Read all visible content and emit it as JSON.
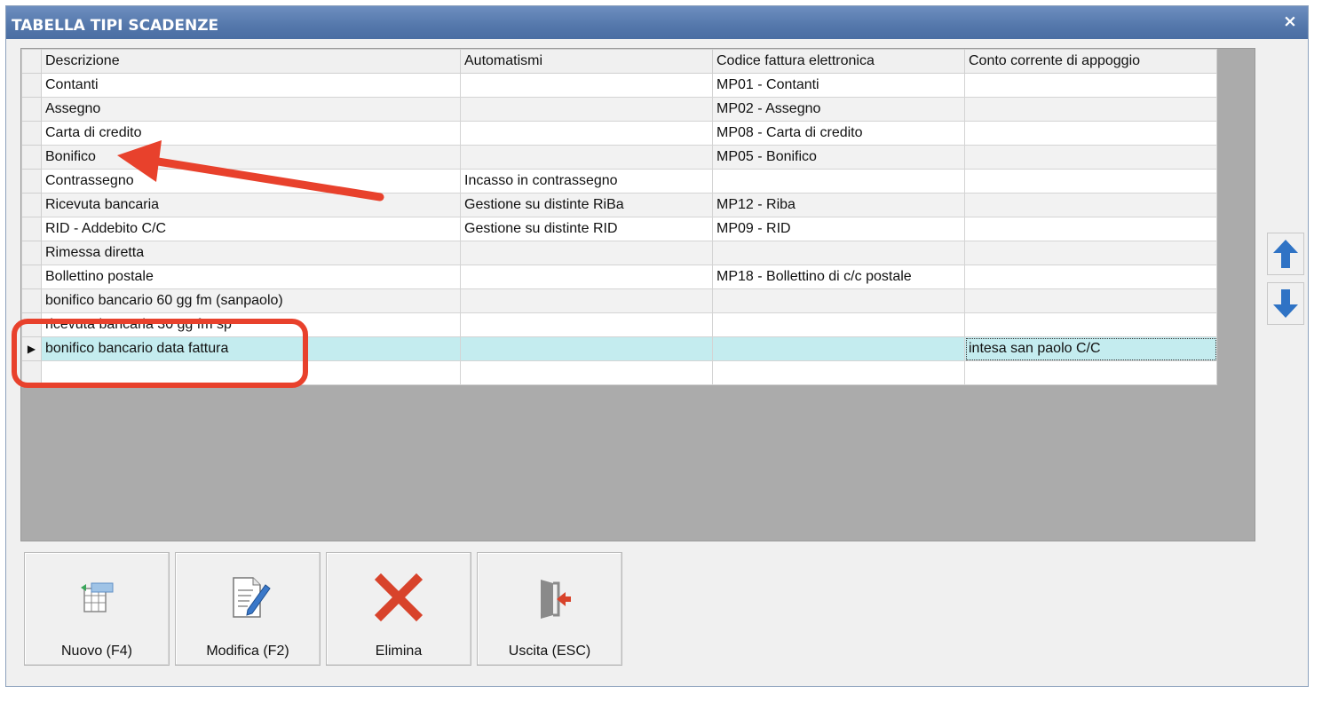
{
  "window": {
    "title": "TABELLA TIPI SCADENZE",
    "close_symbol": "×"
  },
  "grid": {
    "columns": [
      "Descrizione",
      "Automatismi",
      "Codice fattura elettronica",
      "Conto corrente di appoggio"
    ],
    "rows": [
      [
        "Contanti",
        "",
        "MP01 - Contanti",
        ""
      ],
      [
        "Assegno",
        "",
        "MP02 - Assegno",
        ""
      ],
      [
        "Carta di credito",
        "",
        "MP08 - Carta di credito",
        ""
      ],
      [
        "Bonifico",
        "",
        "MP05 - Bonifico",
        ""
      ],
      [
        "Contrassegno",
        "Incasso in contrassegno",
        "",
        ""
      ],
      [
        "Ricevuta bancaria",
        "Gestione su distinte RiBa",
        "MP12 - Riba",
        ""
      ],
      [
        "RID - Addebito C/C",
        "Gestione su distinte RID",
        "MP09 - RID",
        ""
      ],
      [
        "Rimessa diretta",
        "",
        "",
        ""
      ],
      [
        "Bollettino postale",
        "",
        "MP18 - Bollettino di c/c postale",
        ""
      ],
      [
        "bonifico bancario 60 gg fm (sanpaolo)",
        "",
        "",
        ""
      ],
      [
        "ricevuta bancaria 30 gg fm sp",
        "",
        "",
        ""
      ],
      [
        "bonifico bancario data fattura",
        "",
        "",
        "intesa san paolo C/C"
      ],
      [
        "",
        "",
        "",
        ""
      ]
    ],
    "selected_row_index": 11,
    "row_indicator": "▶"
  },
  "side_buttons": {
    "up_icon": "arrow-up-icon",
    "down_icon": "arrow-down-icon"
  },
  "toolbar": {
    "new_label": "Nuovo (F4)",
    "edit_label": "Modifica (F2)",
    "delete_label": "Elimina",
    "exit_label": "Uscita (ESC)"
  },
  "colors": {
    "titlebar": "#5477ab",
    "selected_row": "#c4ecef",
    "annotation": "#e8412c",
    "arrow_buttons": "#2f73c5"
  }
}
